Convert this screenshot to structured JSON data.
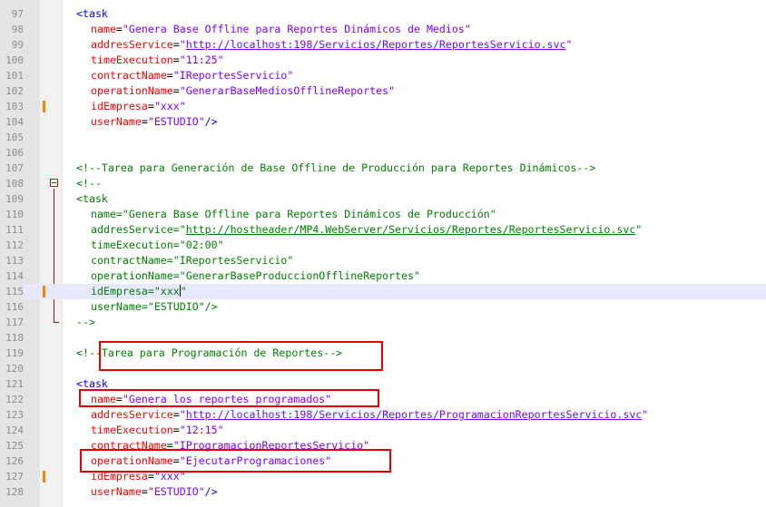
{
  "lines": {
    "l97": {
      "num": "97",
      "text": "<task"
    },
    "l98": {
      "num": "98",
      "attr": "name",
      "val": "Genera Base Offline para Reportes Dinámicos de Medios"
    },
    "l99": {
      "num": "99",
      "attr": "addresService",
      "val": "http://localhost:198/Servicios/Reportes/ReportesServicio.svc"
    },
    "l100": {
      "num": "100",
      "attr": "timeExecution",
      "val": "11:25"
    },
    "l101": {
      "num": "101",
      "attr": "contractName",
      "val": "IReportesServicio"
    },
    "l102": {
      "num": "102",
      "attr": "operationName",
      "val": "GenerarBaseMediosOfflineReportes"
    },
    "l103": {
      "num": "103",
      "attr": "idEmpresa",
      "val": "xxx"
    },
    "l104": {
      "num": "104",
      "attr": "userName",
      "val": "ESTUDIO",
      "close": "/>"
    },
    "l105": {
      "num": "105"
    },
    "l106": {
      "num": "106"
    },
    "l107": {
      "num": "107",
      "text": "<!--Tarea para Generación de Base Offline de Producción para Reportes Dinámicos-->"
    },
    "l108": {
      "num": "108",
      "text": "<!--"
    },
    "l109": {
      "num": "109",
      "text": "<task"
    },
    "l110": {
      "num": "110",
      "attr": "name",
      "val": "Genera Base Offline para Reportes Dinámicos de Producción"
    },
    "l111": {
      "num": "111",
      "attr": "addresService",
      "val": "http://hostheader/MP4.WebServer/Servicios/Reportes/ReportesServicio.svc"
    },
    "l112": {
      "num": "112",
      "attr": "timeExecution",
      "val": "02:00"
    },
    "l113": {
      "num": "113",
      "attr": "contractName",
      "val": "IReportesServicio"
    },
    "l114": {
      "num": "114",
      "attr": "operationName",
      "val": "GenerarBaseProduccionOfflineReportes"
    },
    "l115": {
      "num": "115",
      "attr": "idEmpresa",
      "val": "xxx"
    },
    "l116": {
      "num": "116",
      "attr": "userName",
      "val": "ESTUDIO",
      "close": "/>"
    },
    "l117": {
      "num": "117",
      "text": "-->"
    },
    "l118": {
      "num": "118"
    },
    "l119": {
      "num": "119",
      "text": "<!--Tarea para Programación de Reportes-->"
    },
    "l120": {
      "num": "120"
    },
    "l121": {
      "num": "121",
      "text": "<task"
    },
    "l122": {
      "num": "122",
      "attr": "name",
      "val": "Genera los reportes programados"
    },
    "l123": {
      "num": "123",
      "attr": "addresService",
      "val": "http://localhost:198/Servicios/Reportes/ProgramacionReportesServicio.svc"
    },
    "l124": {
      "num": "124",
      "attr": "timeExecution",
      "val": "12:15"
    },
    "l125": {
      "num": "125",
      "attr": "contractName",
      "val": "IProgramacionReportesServicio"
    },
    "l126": {
      "num": "126",
      "attr": "operationName",
      "val": "EjecutarProgramaciones"
    },
    "l127": {
      "num": "127",
      "attr": "idEmpresa",
      "val": "xxx"
    },
    "l128": {
      "num": "128",
      "attr": "userName",
      "val": "ESTUDIO",
      "close": "/>"
    }
  },
  "syntax": {
    "eq": "=",
    "quote": "\""
  },
  "colors": {
    "tag": "#0000ff",
    "attribute": "#ff0000",
    "value": "#8000ff",
    "comment": "#008000",
    "current_line": "#e8e8ff",
    "change_marker": "#ff8000",
    "highlight_box": "#e60000"
  }
}
